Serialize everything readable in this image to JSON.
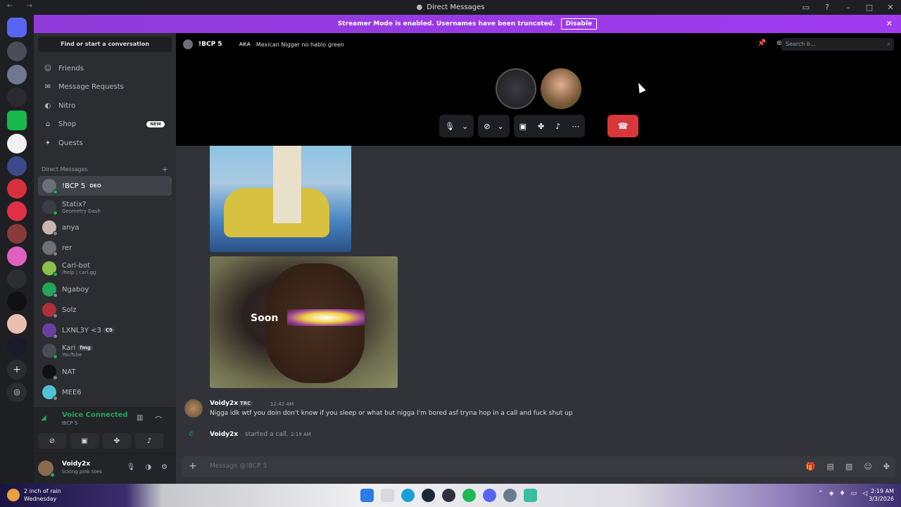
{
  "window": {
    "title": "Direct Messages",
    "nav": "← →"
  },
  "banner": {
    "text": "Streamer Mode is enabled. Usernames have been truncated.",
    "button": "Disable"
  },
  "dm_sidebar": {
    "find": "Find or start a conversation",
    "nav": [
      {
        "label": "Friends",
        "icon": "friends-icon"
      },
      {
        "label": "Message Requests",
        "icon": "mail-icon"
      },
      {
        "label": "Nitro",
        "icon": "nitro-icon"
      },
      {
        "label": "Shop",
        "icon": "shop-icon",
        "badge": "NEW"
      },
      {
        "label": "Quests",
        "icon": "quests-icon"
      }
    ],
    "header": "Direct Messages",
    "dms": [
      {
        "name": "!BCP 5",
        "tag": "DEO",
        "sub": "",
        "color": "#6b6f78",
        "status": "#23a559"
      },
      {
        "name": "Statix?",
        "tag": "",
        "sub": "Geometry Dash",
        "color": "#3a3d44",
        "status": "#23a559"
      },
      {
        "name": "anya",
        "tag": "",
        "sub": "",
        "color": "#c9b7b0",
        "status": "#80848e"
      },
      {
        "name": "rer",
        "tag": "",
        "sub": "",
        "color": "#6f6f76",
        "status": "#80848e"
      },
      {
        "name": "Carl-bot",
        "tag": "",
        "sub": "/help | carl.gg",
        "color": "#8bbf4a",
        "status": "#23a559"
      },
      {
        "name": "Ngaboy",
        "tag": "",
        "sub": "",
        "color": "#23a559",
        "status": "#80848e"
      },
      {
        "name": "Solz",
        "tag": "",
        "sub": "",
        "color": "#b0303a",
        "status": "#80848e"
      },
      {
        "name": "LXNL3Y <3",
        "tag": "C9",
        "sub": "",
        "color": "#6b3fa0",
        "status": "#80848e"
      },
      {
        "name": "Kari",
        "tag": "fmg",
        "sub": "YouTube",
        "color": "#4a4d55",
        "status": "#23a559"
      },
      {
        "name": "NAT",
        "tag": "",
        "sub": "",
        "color": "#111111",
        "status": "#80848e"
      },
      {
        "name": "MEE6",
        "tag": "",
        "sub": "",
        "color": "#4fc3d8",
        "status": "#80848e"
      }
    ]
  },
  "voice": {
    "status": "Voice Connected",
    "channel": "!BCP 5"
  },
  "user": {
    "name": "Voidy2x",
    "status": "licking pink toes"
  },
  "channel": {
    "name": "!BCP 5",
    "aka_label": "AKA",
    "aka": "Mexican Nigger no hablo green",
    "search_placeholder": "Search b..."
  },
  "message": {
    "author": "Voidy2x",
    "tag": "TRC",
    "time": "12:42 AM",
    "text": "Nigga idk wtf you doin don't know if you sleep or what but nigga I'm bored asf tryna hop in a call and fuck shut up"
  },
  "system": {
    "author": "Voidy2x",
    "text": "started a call.",
    "time": "2:19 AM"
  },
  "image2_caption": "Soon",
  "composer": {
    "placeholder": "Message @!BCP 5"
  },
  "taskbar": {
    "weather": "2 inch of rain",
    "day": "Wednesday",
    "time": "2:19 AM",
    "date": "3/3/2026"
  },
  "colors": {
    "accent": "#5865f2",
    "banner": "#9b30ff",
    "online": "#23a559",
    "hangup": "#da373c"
  }
}
